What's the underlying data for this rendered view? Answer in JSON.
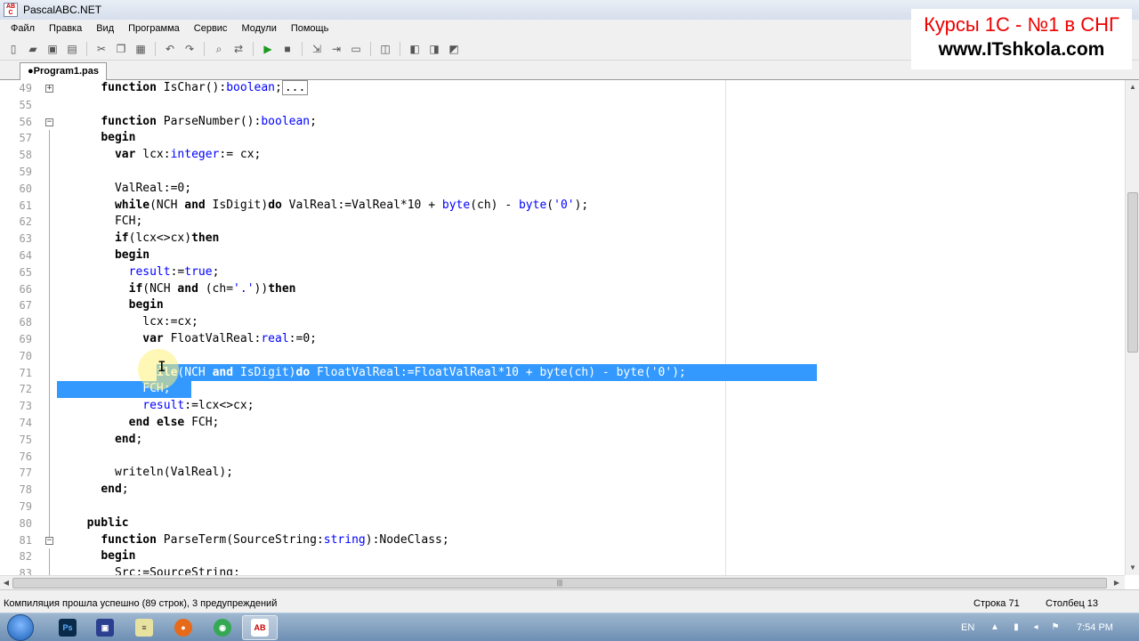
{
  "window": {
    "title": "PascalABC.NET"
  },
  "menu": [
    "Файл",
    "Правка",
    "Вид",
    "Программа",
    "Сервис",
    "Модули",
    "Помощь"
  ],
  "toolbar_icons": [
    "new-file-icon",
    "open-folder-icon",
    "save-icon",
    "save-all-icon",
    "cut-icon",
    "copy-icon",
    "paste-icon",
    "undo-icon",
    "redo-icon",
    "find-icon",
    "replace-icon",
    "run-icon",
    "stop-icon",
    "debug-step-icon",
    "step-over-icon",
    "form-designer-icon",
    "compile-icon",
    "window-cascade-icon",
    "window-tile-icon",
    "window-arrange-icon"
  ],
  "tab": {
    "label": "●Program1.pas"
  },
  "overlay": {
    "line1": "Курсы 1С - №1 в СНГ",
    "line2": "www.ITshkola.com"
  },
  "editor": {
    "lines": [
      {
        "num": "49",
        "code": "    function IsChar():boolean;",
        "fold": "+"
      },
      {
        "num": "55",
        "code": ""
      },
      {
        "num": "56",
        "code": "    function ParseNumber():boolean;",
        "fold": "-"
      },
      {
        "num": "57",
        "code": "    begin"
      },
      {
        "num": "58",
        "code": "      var lcx:integer:= cx;"
      },
      {
        "num": "59",
        "code": ""
      },
      {
        "num": "60",
        "code": "      ValReal:=0;"
      },
      {
        "num": "61",
        "code": "      while(NCH and IsDigit)do ValReal:=ValReal*10 + byte(ch) - byte('0');"
      },
      {
        "num": "62",
        "code": "      FCH;"
      },
      {
        "num": "63",
        "code": "      if(lcx<>cx)then"
      },
      {
        "num": "64",
        "code": "      begin"
      },
      {
        "num": "65",
        "code": "        result:=true;"
      },
      {
        "num": "66",
        "code": "        if(NCH and (ch='.'))then"
      },
      {
        "num": "67",
        "code": "        begin"
      },
      {
        "num": "68",
        "code": "          lcx:=cx;"
      },
      {
        "num": "69",
        "code": "          var FloatValReal:real:=0;"
      },
      {
        "num": "70",
        "code": ""
      },
      {
        "num": "71",
        "code": "          while(NCH and IsDigit)do FloatValReal:=FloatValReal*10 + byte(ch) - byte('0');",
        "selected": true
      },
      {
        "num": "72",
        "code": "          FCH;",
        "selected": true
      },
      {
        "num": "73",
        "code": "          result:=lcx<>cx;"
      },
      {
        "num": "74",
        "code": "        end else FCH;"
      },
      {
        "num": "75",
        "code": "      end;"
      },
      {
        "num": "76",
        "code": ""
      },
      {
        "num": "77",
        "code": "      writeln(ValReal);"
      },
      {
        "num": "78",
        "code": "    end;"
      },
      {
        "num": "79",
        "code": ""
      },
      {
        "num": "80",
        "code": "  public"
      },
      {
        "num": "81",
        "code": "    function ParseTerm(SourceString:string):NodeClass;",
        "fold": "-"
      },
      {
        "num": "82",
        "code": "    begin"
      },
      {
        "num": "83",
        "code": "      Src:=SourceString;"
      }
    ],
    "collapsed_marker": "..."
  },
  "statusbar": {
    "message": "Компиляция прошла успешно (89 строк), 3 предупреждений",
    "row": "Строка  71",
    "col": "Столбец  13"
  },
  "taskbar": {
    "lang": "EN",
    "clock": "7:54 PM"
  }
}
